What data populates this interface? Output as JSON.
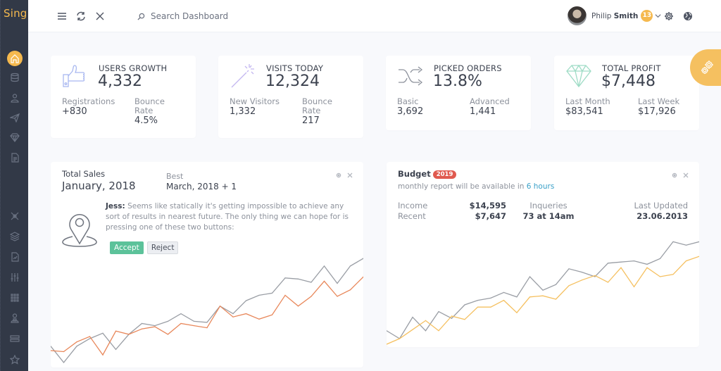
{
  "app": {
    "logo": "Sing"
  },
  "sidebar": {
    "items": [
      {
        "icon": "home-icon",
        "active": true
      },
      {
        "icon": "database-icon"
      },
      {
        "icon": "user-icon"
      },
      {
        "icon": "paper-plane-icon"
      },
      {
        "icon": "diamond-icon"
      },
      {
        "icon": "document-icon"
      },
      {
        "icon": "network-icon"
      },
      {
        "icon": "layers-icon"
      },
      {
        "icon": "chart-document-icon"
      },
      {
        "icon": "sliders-icon"
      },
      {
        "icon": "grid-icon"
      },
      {
        "icon": "user-lock-icon"
      },
      {
        "icon": "stack-icon"
      },
      {
        "icon": "star-icon"
      }
    ]
  },
  "topbar": {
    "menu_icon": "hamburger-icon",
    "refresh_icon": "refresh-icon",
    "close_icon": "close-icon",
    "search_placeholder": "Search Dashboard",
    "user": {
      "first_name": "Philip",
      "last_name": "Smith",
      "notifications": "13"
    },
    "settings_icon": "gear-icon",
    "globe_icon": "globe-icon"
  },
  "stats": [
    {
      "title": "USERS GROWTH",
      "value": "4,332",
      "icon": "thumbs-up-icon",
      "icon_color": "#a9b8f0",
      "subs": [
        {
          "label": "Registrations",
          "value": "+830"
        },
        {
          "label": "Bounce Rate",
          "value": "4.5%"
        }
      ]
    },
    {
      "title": "VISITS TODAY",
      "value": "12,324",
      "icon": "magic-wand-icon",
      "icon_color": "#c3b7f0",
      "subs": [
        {
          "label": "New Visitors",
          "value": "1,332"
        },
        {
          "label": "Bounce Rate",
          "value": "217"
        }
      ]
    },
    {
      "title": "PICKED ORDERS",
      "value": "13.8%",
      "icon": "shuffle-icon",
      "icon_color": "#8d929c",
      "subs": [
        {
          "label": "Basic",
          "value": "3,692"
        },
        {
          "label": "Advanced",
          "value": "1,441"
        }
      ]
    },
    {
      "title": "TOTAL PROFIT",
      "value": "$7,448",
      "icon": "diamond-icon",
      "icon_color": "#9fdcc6",
      "subs": [
        {
          "label": "Last Month",
          "value": "$83,541"
        },
        {
          "label": "Last Week",
          "value": "$17,926"
        }
      ]
    }
  ],
  "sales": {
    "title": "Total Sales",
    "period": "January, 2018",
    "best_label": "Best",
    "best_value": "March, 2018 + 1",
    "message_author": "Jess:",
    "message": "Seems like statically it's getting impossible to achieve any sort of results in nearest future. The only thing we can hope for is pressing one of these two buttons:",
    "accept_label": "Accept",
    "reject_label": "Reject"
  },
  "budget": {
    "title": "Budget",
    "year_badge": "2019",
    "note_prefix": "monthly report will be available in",
    "note_highlight": "6 hours",
    "income_label": "Income",
    "income_value": "$14,595",
    "recent_label": "Recent",
    "recent_value": "$7,647",
    "inqueries_label": "Inqueries",
    "inqueries_value": "73 at 14am",
    "last_updated_label": "Last Updated",
    "last_updated_value": "23.06.2013"
  },
  "colors": {
    "accent": "#f5b94e",
    "accept": "#5cc29a",
    "badge_red": "#e05a4f",
    "link": "#3aa0c8"
  },
  "chart_data": [
    {
      "type": "line",
      "title": "Total Sales",
      "x": [
        1,
        2,
        3,
        4,
        5,
        6,
        7,
        8,
        9,
        10,
        11,
        12,
        13,
        14,
        15,
        16,
        17,
        18,
        19,
        20,
        21,
        22,
        23,
        24,
        25
      ],
      "ylim": [
        0,
        100
      ],
      "grid": false,
      "series": [
        {
          "name": "series-gray",
          "color": "#9a9ea5",
          "values": [
            17,
            2,
            17,
            24,
            29,
            14,
            28,
            38,
            36,
            40,
            47,
            40,
            39,
            54,
            47,
            59,
            64,
            66,
            80,
            79,
            76,
            91,
            75,
            91,
            98
          ]
        },
        {
          "name": "series-orange",
          "color": "#e8875a",
          "values": [
            13,
            12,
            21,
            26,
            9,
            31,
            28,
            33,
            35,
            28,
            38,
            36,
            34,
            54,
            44,
            47,
            42,
            46,
            64,
            54,
            63,
            77,
            63,
            69,
            81
          ]
        }
      ]
    },
    {
      "type": "line",
      "title": "Budget",
      "x": [
        1,
        2,
        3,
        4,
        5,
        6,
        7,
        8,
        9,
        10,
        11,
        12,
        13,
        14,
        15,
        16,
        17,
        18,
        19,
        20,
        21,
        22,
        23,
        24,
        25
      ],
      "ylim": [
        0,
        100
      ],
      "grid": false,
      "series": [
        {
          "name": "series-gray",
          "color": "#9a9ea5",
          "values": [
            12,
            5,
            24,
            12,
            29,
            23,
            35,
            39,
            41,
            46,
            42,
            60,
            48,
            53,
            67,
            64,
            60,
            72,
            73,
            74,
            71,
            76,
            91,
            88,
            91
          ]
        },
        {
          "name": "series-yellow",
          "color": "#f5c060",
          "values": [
            0,
            5,
            13,
            21,
            12,
            25,
            22,
            33,
            33,
            39,
            28,
            42,
            43,
            40,
            52,
            57,
            61,
            55,
            68,
            51,
            68,
            60,
            62,
            74,
            78
          ]
        }
      ]
    }
  ]
}
